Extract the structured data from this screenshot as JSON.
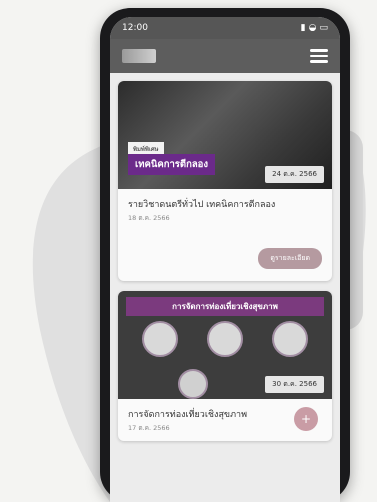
{
  "status": {
    "time": "12:00"
  },
  "cards": [
    {
      "image_badge": "เทคนิคการตีกลอง",
      "image_small_text": "พิมพ์พิเศษ",
      "date": "24 ต.ค. 2566",
      "title": "รายวิชาดนตรีทั่วไป เทคนิคการตีกลอง",
      "subtitle": "18 ต.ค. 2566",
      "button_label": "ดูรายละเอียด"
    },
    {
      "image_banner": "การจัดการท่องเที่ยวเชิงสุขภาพ",
      "date": "30 ต.ค. 2566",
      "title": "การจัดการท่องเที่ยวเชิงสุขภาพ",
      "subtitle": "17 ต.ค. 2566"
    }
  ]
}
